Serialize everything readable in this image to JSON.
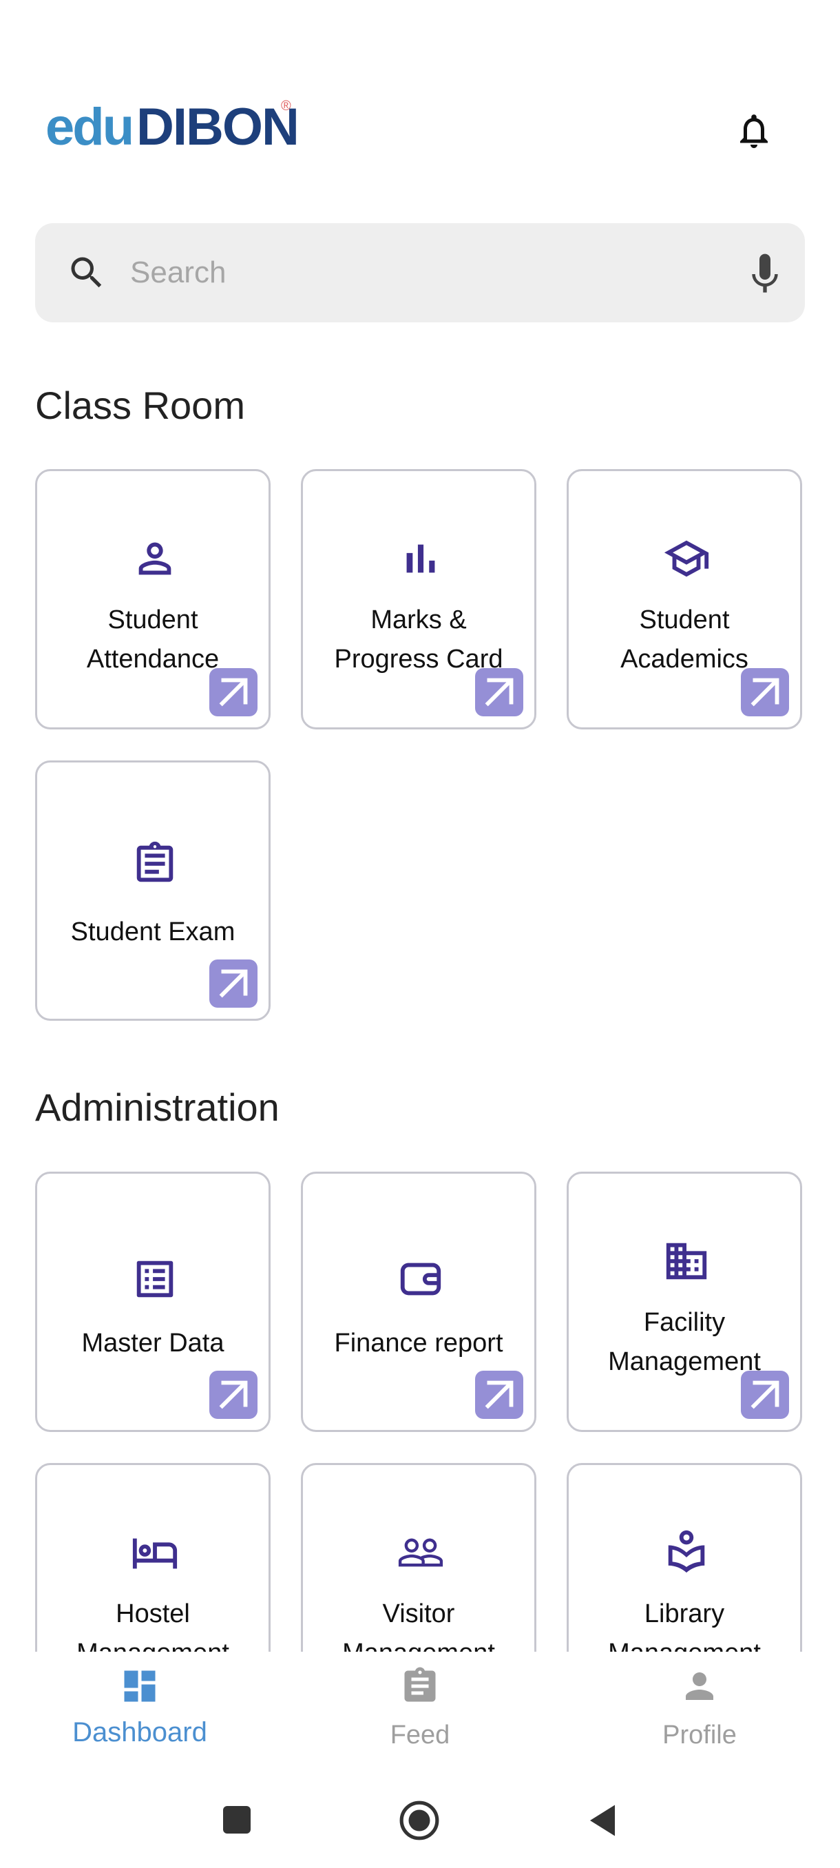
{
  "header": {
    "logo_edu": "edu",
    "logo_dibon": "DIBON",
    "logo_reg": "®",
    "notification_icon": "bell-icon"
  },
  "search": {
    "placeholder": "Search",
    "search_icon": "search-icon",
    "mic_icon": "mic-icon"
  },
  "sections": [
    {
      "title": "Class Room",
      "cards": [
        {
          "label": "Student\nAttendance",
          "icon": "person-icon"
        },
        {
          "label": "Marks &\nProgress Card",
          "icon": "bar-chart-icon"
        },
        {
          "label": "Student\nAcademics",
          "icon": "graduation-cap-icon"
        },
        {
          "label": "Student Exam",
          "icon": "clipboard-icon"
        }
      ]
    },
    {
      "title": "Administration",
      "cards": [
        {
          "label": "Master Data",
          "icon": "list-icon"
        },
        {
          "label": "Finance report",
          "icon": "wallet-icon"
        },
        {
          "label": "Facility\nManagement",
          "icon": "building-icon"
        },
        {
          "label": "Hostel\nManagement",
          "icon": "bed-icon"
        },
        {
          "label": "Visitor\nManagement",
          "icon": "people-icon"
        },
        {
          "label": "Library\nManagement",
          "icon": "book-reader-icon"
        }
      ]
    }
  ],
  "bottom_nav": {
    "items": [
      {
        "label": "Dashboard",
        "icon": "dashboard-icon",
        "active": true
      },
      {
        "label": "Feed",
        "icon": "feed-icon",
        "active": false
      },
      {
        "label": "Profile",
        "icon": "profile-icon",
        "active": false
      }
    ]
  },
  "colors": {
    "accent": "#3f2f8e",
    "arrow_bg": "#958fd6",
    "nav_active": "#4b8fd0",
    "nav_inactive": "#9e9e9e"
  },
  "system_nav": [
    "recents-button",
    "home-button",
    "back-button"
  ]
}
